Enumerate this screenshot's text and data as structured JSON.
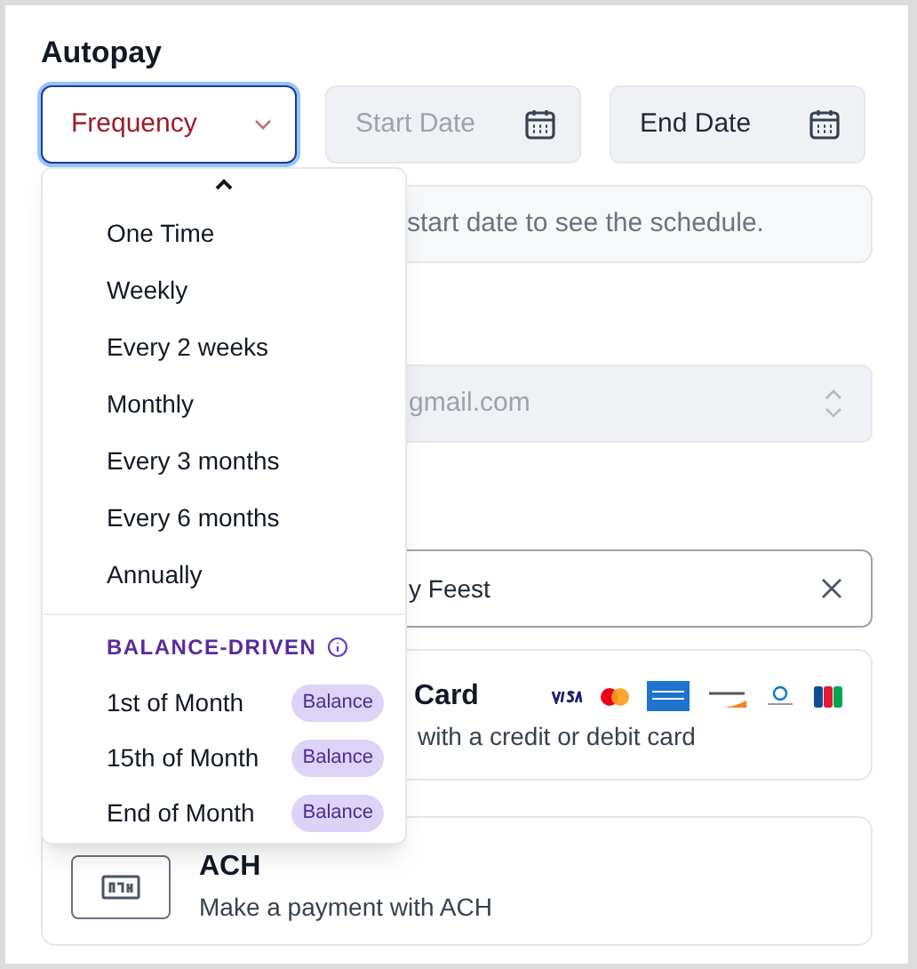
{
  "title": "Autopay",
  "frequency": {
    "placeholder": "Frequency",
    "expanded": true
  },
  "start_date": {
    "placeholder": "Start Date",
    "disabled": true
  },
  "end_date": {
    "placeholder": "End Date",
    "disabled": false
  },
  "schedule_note": "start date to see the schedule.",
  "email_select": {
    "value": "gmail.com"
  },
  "name_field": {
    "value": "y Feest"
  },
  "payment_methods": [
    {
      "kind": "card",
      "title": "Card",
      "description": "with a credit or debit card"
    },
    {
      "kind": "ach",
      "title": "ACH",
      "description": "Make a payment with ACH"
    }
  ],
  "frequency_menu": {
    "items": [
      {
        "label": "One Time"
      },
      {
        "label": "Weekly"
      },
      {
        "label": "Every 2 weeks"
      },
      {
        "label": "Monthly"
      },
      {
        "label": "Every 3 months"
      },
      {
        "label": "Every 6 months"
      },
      {
        "label": "Annually"
      }
    ],
    "section": {
      "label": "BALANCE-DRIVEN",
      "items": [
        {
          "label": "1st of Month",
          "badge": "Balance"
        },
        {
          "label": "15th of Month",
          "badge": "Balance"
        },
        {
          "label": "End of Month",
          "badge": "Balance"
        }
      ]
    }
  }
}
